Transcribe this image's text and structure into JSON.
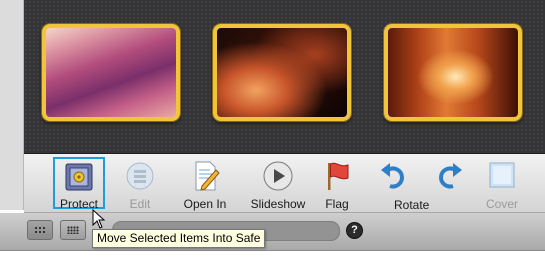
{
  "thumbnails": [
    {
      "name": "pink-canyon-photo",
      "selected": true
    },
    {
      "name": "dark-canyon-photo",
      "selected": true
    },
    {
      "name": "canyon-light-beam-photo",
      "selected": true
    }
  ],
  "toolbar": {
    "protect": "Protect",
    "edit": "Edit",
    "open_in": "Open In",
    "slideshow": "Slideshow",
    "flag": "Flag",
    "rotate": "Rotate",
    "cover": "Cover"
  },
  "bottom": {
    "help": "?"
  },
  "tooltip": "Move Selected Items Into Safe",
  "colors": {
    "selection_border": "#f0c53a",
    "focus_ring": "#1e9ed8",
    "tooltip_bg": "#ffffe1"
  }
}
